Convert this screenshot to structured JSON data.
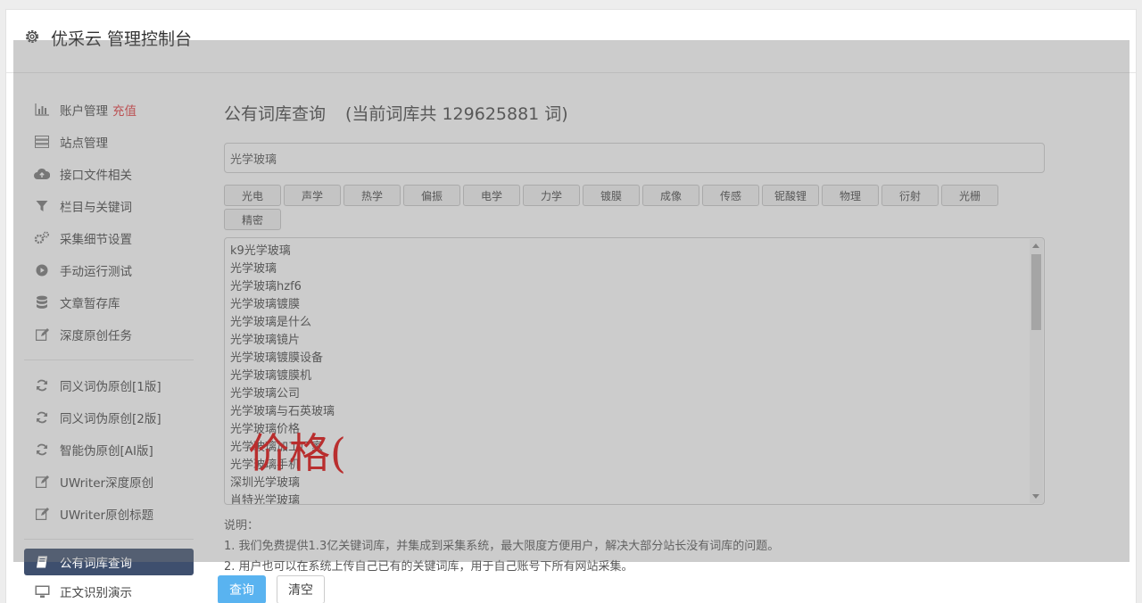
{
  "header": {
    "title": "优采云 管理控制台"
  },
  "sidebar": {
    "account": {
      "label": "账户管理",
      "badge": "充值"
    },
    "group1": [
      {
        "label": "站点管理",
        "icon": "server-icon"
      },
      {
        "label": "接口文件相关",
        "icon": "cloud-upload-icon"
      },
      {
        "label": "栏目与关键词",
        "icon": "filter-icon"
      },
      {
        "label": "采集细节设置",
        "icon": "cogs-icon"
      },
      {
        "label": "手动运行测试",
        "icon": "play-circle-icon"
      },
      {
        "label": "文章暂存库",
        "icon": "database-icon"
      },
      {
        "label": "深度原创任务",
        "icon": "edit-icon"
      }
    ],
    "group2": [
      {
        "label": "同义词伪原创[1版]",
        "icon": "refresh-icon"
      },
      {
        "label": "同义词伪原创[2版]",
        "icon": "refresh-icon"
      },
      {
        "label": "智能伪原创[AI版]",
        "icon": "refresh-icon"
      },
      {
        "label": "UWriter深度原创",
        "icon": "edit-icon"
      },
      {
        "label": "UWriter原创标题",
        "icon": "edit-icon"
      }
    ],
    "active": {
      "label": "公有词库查询",
      "icon": "book-icon"
    },
    "after": {
      "label": "正文识别演示",
      "icon": "monitor-icon"
    }
  },
  "main": {
    "title": "公有词库查询",
    "count_text": "(当前词库共 129625881 词)",
    "search_value": "光学玻璃",
    "tags": [
      "光电",
      "声学",
      "热学",
      "偏振",
      "电学",
      "力学",
      "镀膜",
      "成像",
      "传感",
      "铌酸锂",
      "物理",
      "衍射",
      "光栅",
      "精密"
    ],
    "results": [
      "k9光学玻璃",
      "光学玻璃",
      "光学玻璃hzf6",
      "光学玻璃镀膜",
      "光学玻璃是什么",
      "光学玻璃镜片",
      "光学玻璃镀膜设备",
      "光学玻璃镀膜机",
      "光学玻璃公司",
      "光学玻璃与石英玻璃",
      "光学玻璃价格",
      "光学玻璃加工厂家",
      "光学玻璃手机",
      "深圳光学玻璃",
      "肖特光学玻璃"
    ],
    "overlay_text": "价格(",
    "notes": {
      "title": "说明：",
      "line1": "1. 我们免费提供1.3亿关键词库，并集成到采集系统，最大限度方便用户，解决大部分站长没有词库的问题。",
      "line2": "2. 用户也可以在系统上传自己已有的关键词库，用于自己账号下所有网站采集。"
    },
    "buttons": {
      "query": "查询",
      "clear": "清空"
    }
  }
}
